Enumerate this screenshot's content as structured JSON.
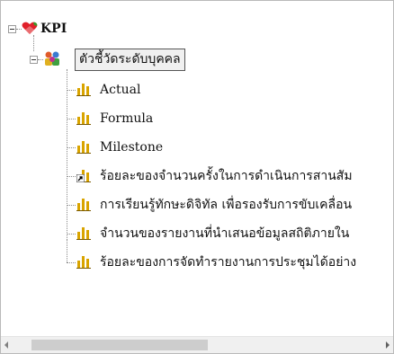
{
  "tree": {
    "root": {
      "label": "KPI",
      "icon": "heart-icon",
      "expanded": true
    },
    "group": {
      "label": "ตัวชี้วัดระดับบุคคล",
      "icon": "people-group-icon",
      "expanded": true,
      "selected": true
    },
    "items": [
      {
        "label": "Actual",
        "icon": "bar-chart-icon"
      },
      {
        "label": "Formula",
        "icon": "bar-chart-icon"
      },
      {
        "label": "Milestone",
        "icon": "bar-chart-icon"
      },
      {
        "label": "ร้อยละของจำนวนครั้งในการดำเนินการสานสัม",
        "icon": "bar-chart-shortcut-icon"
      },
      {
        "label": "การเรียนรู้ทักษะดิจิทัล เพื่อรองรับการขับเคลื่อน",
        "icon": "bar-chart-icon"
      },
      {
        "label": "จำนวนของรายงานที่นำเสนอข้อมูลสถิติภายใน",
        "icon": "bar-chart-icon"
      },
      {
        "label": "ร้อยละของการจัดทำรายงานการประชุมได้อย่าง",
        "icon": "bar-chart-icon"
      }
    ]
  },
  "colors": {
    "bar": "#d9a400",
    "heart_red": "#e0202a",
    "heart_green": "#3a9a2a",
    "selection_border": "#555555"
  },
  "scrollbar": {
    "horizontal_thumb_fraction": 0.49
  }
}
